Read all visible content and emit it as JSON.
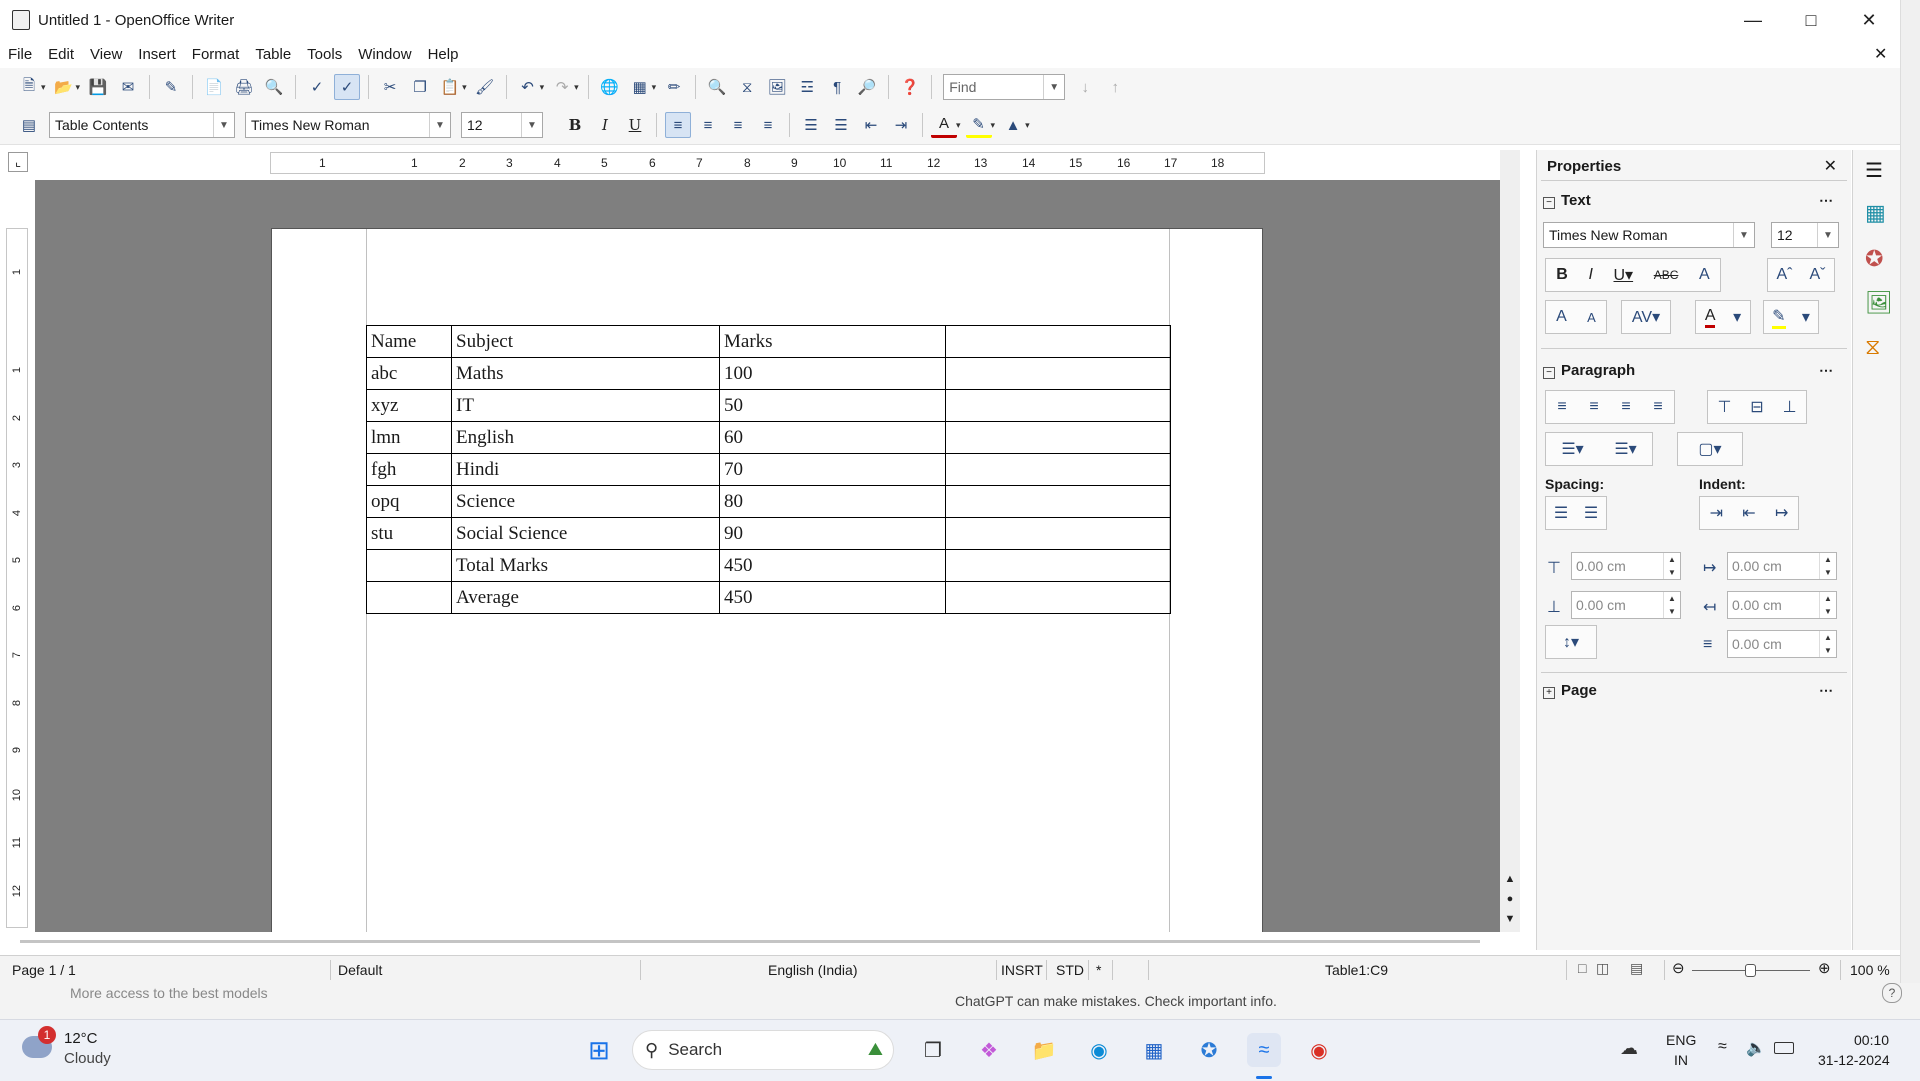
{
  "window": {
    "title": "Untitled 1 - OpenOffice Writer"
  },
  "menu": [
    "File",
    "Edit",
    "View",
    "Insert",
    "Format",
    "Table",
    "Tools",
    "Window",
    "Help"
  ],
  "toolbar": {
    "find_placeholder": "Find",
    "paragraph_style": "Table Contents",
    "font_name": "Times New Roman",
    "font_size": "12"
  },
  "ruler": {
    "h_ticks": [
      "1",
      "1",
      "2",
      "3",
      "4",
      "5",
      "6",
      "7",
      "8",
      "9",
      "10",
      "11",
      "12",
      "13",
      "14",
      "15",
      "16",
      "17",
      "18"
    ],
    "v_ticks": [
      "1",
      "1",
      "2",
      "3",
      "4",
      "5",
      "6",
      "7",
      "8",
      "9",
      "10",
      "11",
      "12"
    ]
  },
  "document": {
    "table": [
      [
        "Name",
        " Subject",
        "Marks",
        ""
      ],
      [
        "abc",
        "Maths",
        "100",
        ""
      ],
      [
        "xyz",
        "IT",
        "50",
        ""
      ],
      [
        "lmn",
        "English",
        "60",
        ""
      ],
      [
        "fgh",
        "Hindi",
        "70",
        ""
      ],
      [
        "opq",
        "Science",
        "80",
        ""
      ],
      [
        "stu",
        "Social Science",
        "90",
        ""
      ],
      [
        "",
        "Total Marks",
        "450",
        ""
      ],
      [
        "",
        "Average",
        "450",
        ""
      ]
    ]
  },
  "sidebar": {
    "title": "Properties",
    "text_section": "Text",
    "font_name": "Times New Roman",
    "font_size": "12",
    "paragraph_section": "Paragraph",
    "spacing_label": "Spacing:",
    "indent_label": "Indent:",
    "spacing_above": "0.00 cm",
    "spacing_below": "0.00 cm",
    "indent_before": "0.00 cm",
    "indent_after": "0.00 cm",
    "indent_first": "0.00 cm",
    "page_section": "Page"
  },
  "status": {
    "page": "Page 1 / 1",
    "style": "Default",
    "language": "English (India)",
    "insert_mode": "INSRT",
    "selection_mode": "STD",
    "modified": "*",
    "cell": "Table1:C9",
    "zoom": "100 %"
  },
  "chat": {
    "left": "More access to the best models",
    "center": "ChatGPT can make mistakes. Check important info."
  },
  "taskbar": {
    "weather_temp": "12°C",
    "weather_desc": "Cloudy",
    "weather_badge": "1",
    "search_label": "Search",
    "lang_top": "ENG",
    "lang_bottom": "IN",
    "time": "00:10",
    "date": "31-12-2024"
  }
}
